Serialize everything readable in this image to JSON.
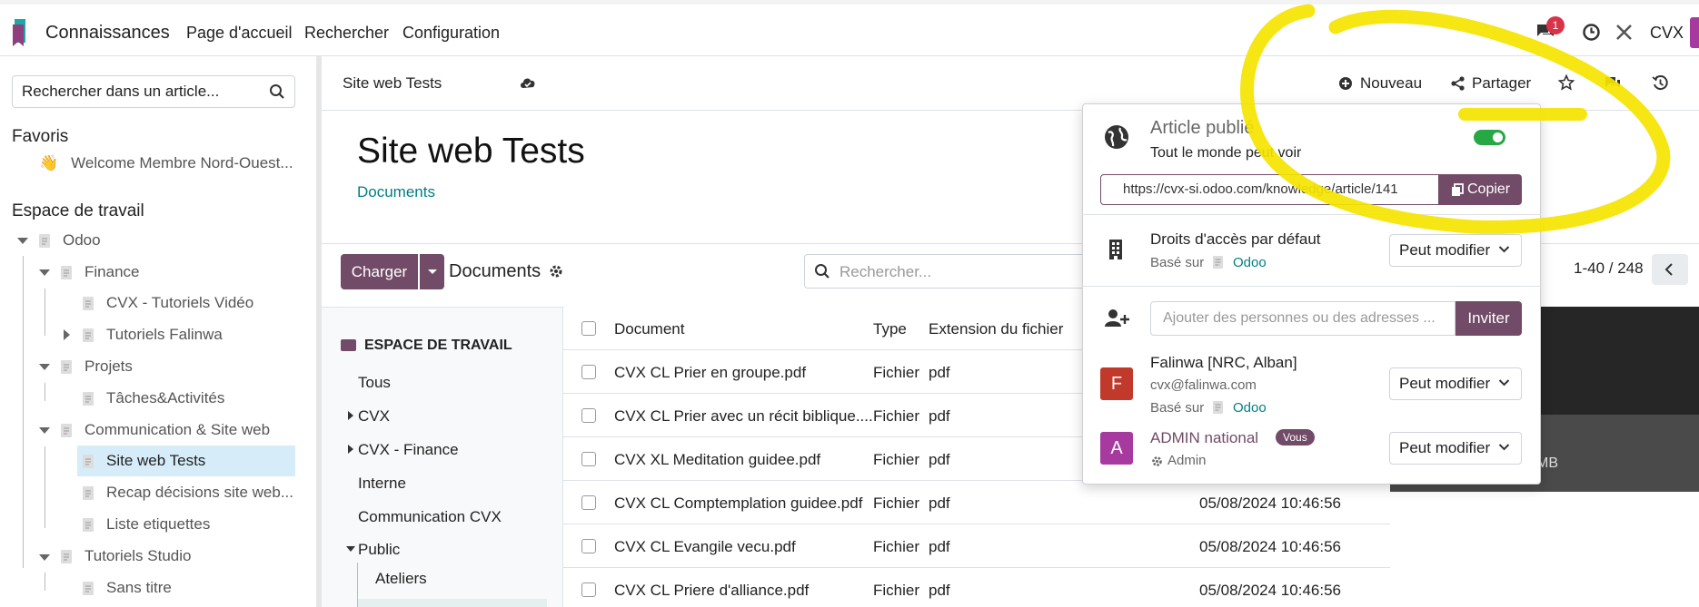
{
  "topbar": {
    "app_name": "Connaissances",
    "menu": [
      "Page d'accueil",
      "Rechercher",
      "Configuration"
    ],
    "notification_count": "1",
    "company": "CVX"
  },
  "sidebar": {
    "search_placeholder": "Rechercher dans un article...",
    "favorites_title": "Favoris",
    "favorite_item": "Welcome Membre Nord-Ouest...",
    "favorite_emoji": "👋",
    "workspace_title": "Espace de travail",
    "tree": [
      "Odoo",
      "Finance",
      "CVX - Tutoriels Vidéo",
      "Tutoriels Falinwa",
      "Projets",
      "Tâches&Activités",
      "Communication & Site web",
      "Site web Tests",
      "Recap décisions site web...",
      "Liste etiquettes",
      "Tutoriels Studio",
      "Sans titre"
    ]
  },
  "header": {
    "breadcrumb": "Site web Tests",
    "new_label": "Nouveau",
    "share_label": "Partager"
  },
  "article": {
    "title": "Site web Tests",
    "link": "Documents"
  },
  "documents": {
    "upload_label": "Charger",
    "section_label": "Documents",
    "search_placeholder": "Rechercher...",
    "pager": "1-40 / 248",
    "facet_header": "ESPACE DE TRAVAIL",
    "facets": [
      "Tous",
      "CVX",
      "CVX - Finance",
      "Interne",
      "Communication CVX",
      "Public",
      "Ateliers"
    ],
    "columns": [
      "Document",
      "Type",
      "Extension du fichier"
    ],
    "rows": [
      {
        "name": "CVX CL Prier en groupe.pdf",
        "type": "Fichier",
        "ext": "pdf",
        "date": ""
      },
      {
        "name": "CVX CL Prier avec un récit biblique....",
        "type": "Fichier",
        "ext": "pdf",
        "date": ""
      },
      {
        "name": "CVX XL Meditation guidee.pdf",
        "type": "Fichier",
        "ext": "pdf",
        "date": ""
      },
      {
        "name": "CVX CL Comptemplation guidee.pdf",
        "type": "Fichier",
        "ext": "pdf",
        "date": "05/08/2024 10:46:56"
      },
      {
        "name": "CVX CL Evangile vecu.pdf",
        "type": "Fichier",
        "ext": "pdf",
        "date": "05/08/2024 10:46:56"
      },
      {
        "name": "CVX CL Priere d'alliance.pdf",
        "type": "Fichier",
        "ext": "pdf",
        "date": "05/08/2024 10:46:56"
      }
    ],
    "preview_text": "MB"
  },
  "share_popover": {
    "title": "Article publié",
    "subtitle": "Tout le monde peut voir",
    "url": "https://cvx-si.odoo.com/knowledge/article/141",
    "copy_label": "Copier",
    "default_access_label": "Droits d'accès par défaut",
    "based_on": "Basé sur",
    "based_on_article": "Odoo",
    "permission": "Peut modifier",
    "invite_placeholder": "Ajouter des personnes ou des adresses ...",
    "invite_label": "Inviter",
    "members": [
      {
        "initial": "F",
        "name": "Falinwa [NRC, Alban]",
        "email": "cvx@falinwa.com",
        "based_on": "Basé sur",
        "article": "Odoo",
        "permission": "Peut modifier",
        "color": "#c0392b"
      },
      {
        "initial": "A",
        "name": "ADMIN national",
        "badge": "Vous",
        "role": "Admin",
        "permission": "Peut modifier",
        "color": "#a73a9f"
      }
    ]
  },
  "colors": {
    "brand": "#714b67",
    "teal": "#017e84",
    "toggle_on": "#28a745",
    "highlight": "#f5e400"
  }
}
